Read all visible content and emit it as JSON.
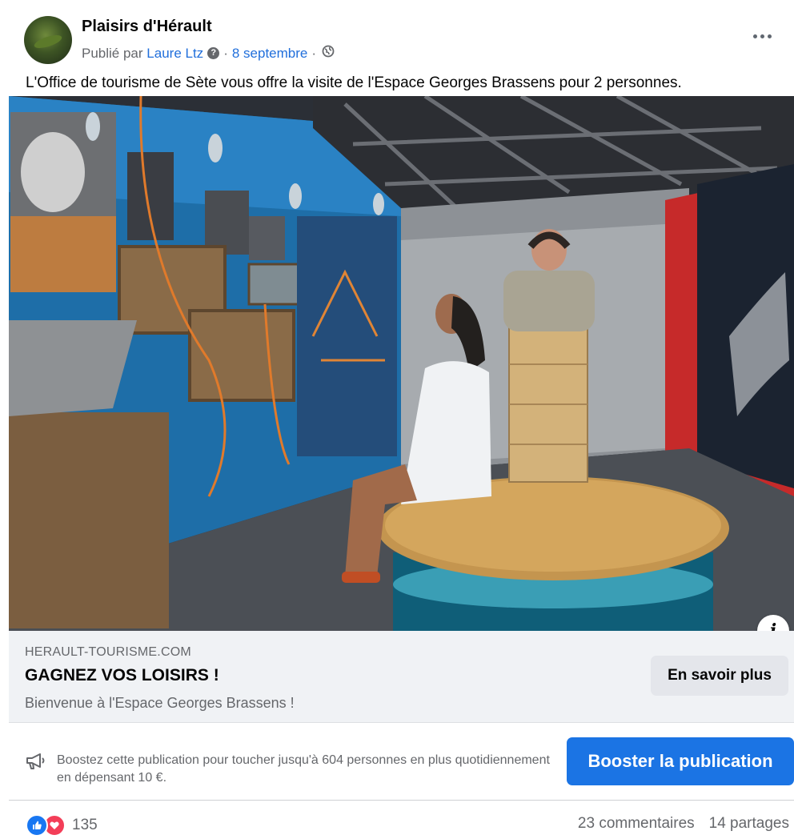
{
  "post": {
    "page_name": "Plaisirs d'Hérault",
    "published_prefix": "Publié par",
    "author": "Laure Ltz",
    "author_badge": "?",
    "date": "8 septembre",
    "separator": "·",
    "caption": "L'Office de tourisme de Sète vous offre la visite de l'Espace Georges Brassens pour 2 personnes."
  },
  "link_card": {
    "domain": "HERAULT-TOURISME.COM",
    "headline": "GAGNEZ VOS LOISIRS !",
    "description": "Bienvenue à l'Espace Georges Brassens !",
    "cta_label": "En savoir plus",
    "info_label": "i"
  },
  "boost": {
    "text": "Boostez cette publication pour toucher jusqu'à 604 personnes en plus quotidiennement en dépensant 10 €.",
    "button_label": "Booster la publication"
  },
  "engagement": {
    "reactions_count": "135",
    "comments": "23 commentaires",
    "shares": "14 partages"
  },
  "colors": {
    "accent": "#1b74e4",
    "link": "#216fdb",
    "like": "#1877f2",
    "love": "#f33e58"
  },
  "icons": {
    "more": "more-options-icon",
    "globe": "globe-icon",
    "megaphone": "megaphone-icon",
    "info": "info-icon",
    "like": "like-reaction-icon",
    "love": "love-reaction-icon"
  }
}
